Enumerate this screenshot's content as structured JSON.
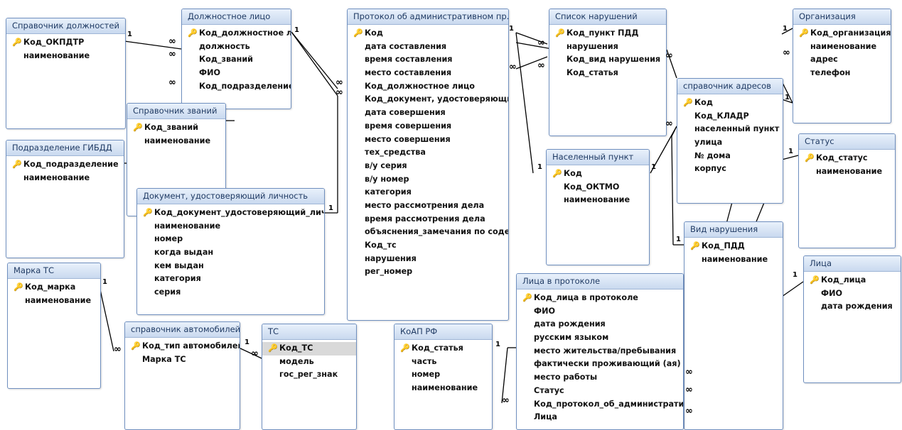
{
  "cards": {
    "one": "1",
    "many": "∞"
  },
  "tables": {
    "sprav_dolzhn": {
      "title": "Справочник должностей",
      "fields": [
        "Код_ОКПДТР",
        "наименование"
      ]
    },
    "dolzhn_litso": {
      "title": "Должностное лицо",
      "fields": [
        "Код_должностное ли",
        "должность",
        "Код_званий",
        "ФИО",
        "Код_подразделение"
      ]
    },
    "protokol": {
      "title": "Протокол об административном пр...",
      "fields": [
        "Код",
        "дата составления",
        "время составления",
        "место составления",
        "Код_должностное лицо",
        "Код_документ, удостоверяющий ли",
        "дата совершения",
        "время совершения",
        "место совершения",
        "тех_средства",
        "в/у серия",
        "в/у номер",
        "категория",
        "место рассмотрения дела",
        "время рассмотрения дела",
        "объяснения_замечания по содерж",
        "Код_тс",
        "нарушения",
        "рег_номер"
      ]
    },
    "spisok_narush": {
      "title": "Список нарушений",
      "fields": [
        "Код_пункт ПДД",
        "нарушения",
        "Код_вид нарушения",
        "Код_статья"
      ]
    },
    "organizatsiya": {
      "title": "Организация",
      "fields": [
        "Код_организация",
        "наименование",
        "адрес",
        "телефон"
      ]
    },
    "sprav_adresov": {
      "title": "справочник адресов",
      "fields": [
        "Код",
        "Код_КЛАДР",
        "населенный пункт",
        "улица",
        "№ дома",
        "корпус"
      ]
    },
    "status": {
      "title": "Статус",
      "fields": [
        "Код_статус",
        "наименование"
      ]
    },
    "nas_punkt": {
      "title": "Населенный пункт",
      "fields": [
        "Код",
        "Код_ОКТМО",
        "наименование"
      ]
    },
    "sprav_zvaniy": {
      "title": "Справочник званий",
      "fields": [
        "Код_званий",
        "наименование"
      ]
    },
    "podrazd": {
      "title": "Подразделение ГИБДД",
      "fields": [
        "Код_подразделение",
        "наименование"
      ]
    },
    "dokument": {
      "title": "Документ, удостоверяющий личность",
      "fields": [
        "Код_документ_удостоверяющий_личность",
        "наименование",
        "номер",
        "когда выдан",
        "кем выдан",
        "категория",
        "серия"
      ]
    },
    "vid_narush": {
      "title": "Вид нарушения",
      "fields": [
        "Код_ПДД",
        "наименование"
      ]
    },
    "litsa": {
      "title": "Лица",
      "fields": [
        "Код_лица",
        "ФИО",
        "дата рождения"
      ]
    },
    "marka": {
      "title": "Марка ТС",
      "fields": [
        "Код_марка",
        "наименование"
      ]
    },
    "sprav_avto": {
      "title": "справочник автомобилей",
      "fields": [
        "Код_тип автомобилей",
        "Марка ТС"
      ]
    },
    "ts": {
      "title": "ТС",
      "fields": [
        "Код_ТС",
        "модель",
        "гос_рег_знак"
      ]
    },
    "koap": {
      "title": "КоАП РФ",
      "fields": [
        "Код_статья",
        "часть",
        "номер",
        "наименование"
      ]
    },
    "litsa_protokol": {
      "title": "Лица в протоколе",
      "fields": [
        "Код_лица в протоколе",
        "ФИО",
        "дата рождения",
        "русским языком",
        "место жительства/пребывания",
        "фактически проживающий (ая)",
        "место работы",
        "Статус",
        "Код_протокол_об_административном",
        "Лица"
      ]
    }
  }
}
